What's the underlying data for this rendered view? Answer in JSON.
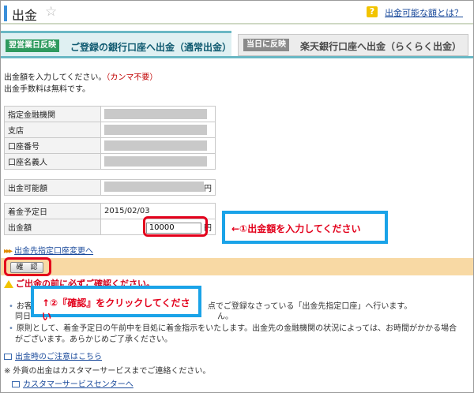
{
  "header": {
    "title": "出金",
    "help_icon_text": "?",
    "help_link": "出金可能な額とは？"
  },
  "tabs": {
    "active_badge": "翌営業日反映",
    "active_label": "ご登録の銀行口座へ出金（通常出金）",
    "inactive_badge": "当日に反映",
    "inactive_label": "楽天銀行口座へ出金（らくらく出金）"
  },
  "intro": {
    "line1": "出金額を入力してください。",
    "line1_red": "（カンマ不要）",
    "line2": "出金手数料は無料です。"
  },
  "account": {
    "bank_label": "指定金融機関",
    "branch_label": "支店",
    "number_label": "口座番号",
    "holder_label": "口座名義人"
  },
  "available": {
    "label": "出金可能額",
    "unit": "円"
  },
  "schedule": {
    "date_label": "着金予定日",
    "date_value": "2015/02/03",
    "amount_label": "出金額",
    "amount_value": "10000",
    "unit": "円"
  },
  "callouts": {
    "step1": "←①出金額を入力してください",
    "step2": "↑②『確認』をクリックしてください"
  },
  "change_link": "出金先指定口座変更へ",
  "confirm_button": "確　認",
  "warning": "ご出金の前に必ずご確認ください。",
  "notes": {
    "n1_start": "お客",
    "n1_end": "点でご登録なさっている「出金先指定口座」へ行います。",
    "n1_sub_start": "同日",
    "n1_sub_end": "ん。",
    "n2": "原則として、着金予定日の午前中を目処に着金指示をいたします。出金先の金融機関の状況によっては、お時間がかかる場合",
    "n2_cont": "がございます。あらかじめご了承ください。"
  },
  "links": {
    "caution": "出金時のご注意はこちら",
    "customer_service": "カスタマーサービスセンターへ"
  },
  "footer_note": "※ 外貨の出金はカスタマーサービスまでご連絡ください。",
  "colors": {
    "accent_teal": "#6ab8c4",
    "highlight_red": "#e3001b",
    "callout_blue": "#1aa3e8",
    "confirm_band": "#f8d9a4"
  }
}
